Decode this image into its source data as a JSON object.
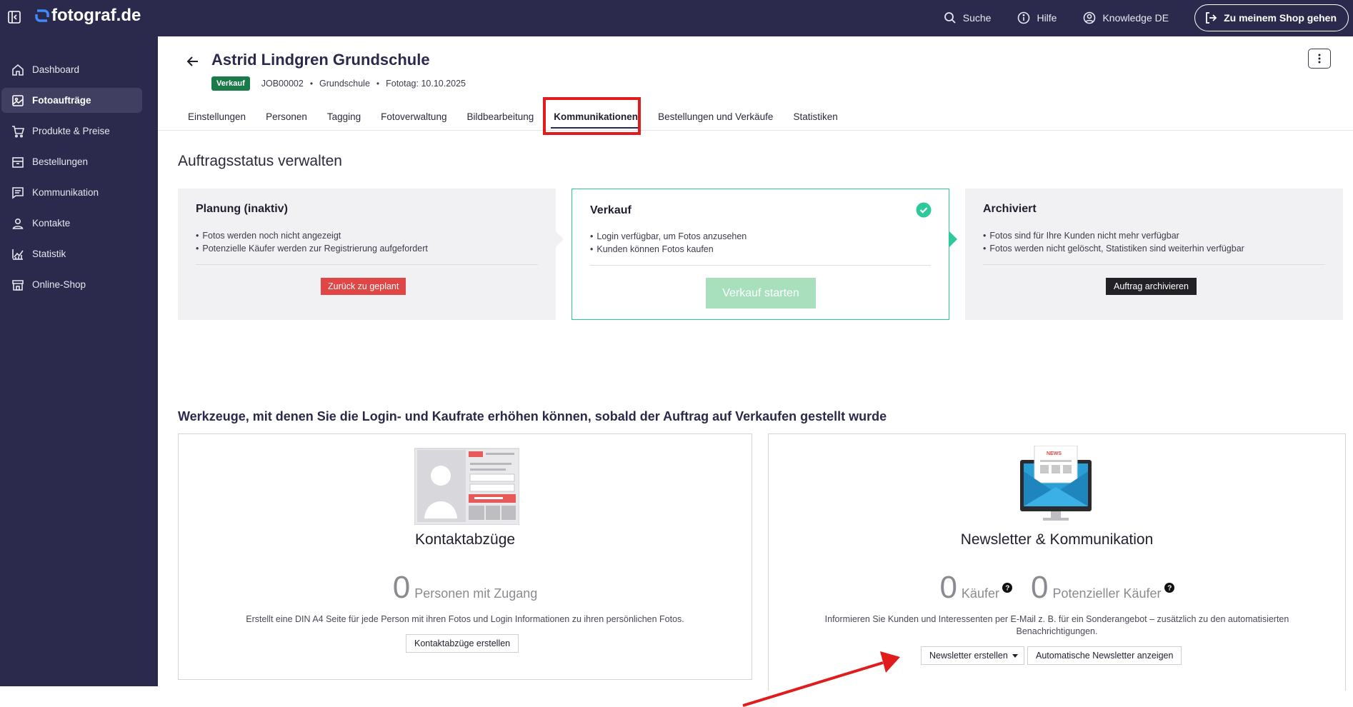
{
  "topbar": {
    "logo_text": "fotograf.de",
    "search_label": "Suche",
    "help_label": "Hilfe",
    "account_label": "Knowledge DE",
    "shop_button": "Zu meinem Shop gehen"
  },
  "sidebar": {
    "items": [
      {
        "label": "Dashboard",
        "icon": "home-icon"
      },
      {
        "label": "Fotoaufträge",
        "icon": "image-icon",
        "active": true
      },
      {
        "label": "Produkte & Preise",
        "icon": "cart-icon"
      },
      {
        "label": "Bestellungen",
        "icon": "box-icon"
      },
      {
        "label": "Kommunikation",
        "icon": "message-icon"
      },
      {
        "label": "Kontakte",
        "icon": "person-icon"
      },
      {
        "label": "Statistik",
        "icon": "chart-icon"
      },
      {
        "label": "Online-Shop",
        "icon": "store-icon"
      }
    ]
  },
  "header": {
    "title": "Astrid Lindgren Grundschule",
    "badge": "Verkauf",
    "job_id": "JOB00002",
    "type": "Grundschule",
    "photo_day": "Fototag: 10.10.2025"
  },
  "tabs": [
    {
      "label": "Einstellungen"
    },
    {
      "label": "Personen"
    },
    {
      "label": "Tagging"
    },
    {
      "label": "Fotoverwaltung"
    },
    {
      "label": "Bildbearbeitung"
    },
    {
      "label": "Kommunikationen",
      "active": true
    },
    {
      "label": "Bestellungen und Verkäufe"
    },
    {
      "label": "Statistiken"
    }
  ],
  "status_section": {
    "title": "Auftragsstatus verwalten",
    "cards": [
      {
        "title": "Planung (inaktiv)",
        "bullets": [
          "Fotos werden noch nicht angezeigt",
          "Potenzielle Käufer werden zur Registrierung aufgefordert"
        ],
        "button": "Zurück zu geplant"
      },
      {
        "title": "Verkauf",
        "bullets": [
          "Login verfügbar, um Fotos anzusehen",
          "Kunden können Fotos kaufen"
        ],
        "button": "Verkauf starten"
      },
      {
        "title": "Archiviert",
        "bullets": [
          "Fotos sind für Ihre Kunden nicht mehr verfügbar",
          "Fotos werden nicht gelöscht, Statistiken sind weiterhin verfügbar"
        ],
        "button": "Auftrag archivieren"
      }
    ]
  },
  "tools_section": {
    "title": "Werkzeuge, mit denen Sie die Login- und Kaufrate erhöhen können, sobald der Auftrag auf Verkaufen gestellt wurde",
    "contact_sheets": {
      "name": "Kontaktabzüge",
      "count": "0",
      "count_label": "Personen mit Zugang",
      "description": "Erstellt eine DIN A4 Seite für jede Person mit ihren Fotos und Login Informationen zu ihren persönlichen Fotos.",
      "button": "Kontaktabzüge erstellen"
    },
    "newsletter": {
      "name": "Newsletter & Kommunikation",
      "image_text": "NEWS",
      "buyers_count": "0",
      "buyers_label": "Käufer",
      "potential_count": "0",
      "potential_label": "Potenzieller Käufer",
      "description": "Informieren Sie Kunden und Interessenten per E-Mail z. B. für ein Sonderangebot – zusätzlich zu den automatisierten Benachrichtigungen.",
      "create_button": "Newsletter erstellen",
      "auto_button": "Automatische Newsletter anzeigen"
    }
  },
  "colors": {
    "nav_bg": "#2b2a4c",
    "accent_green": "#2ec99a",
    "badge_green": "#1a7a4a",
    "danger_red": "#e04646",
    "annotation_red": "#e01c1c"
  }
}
